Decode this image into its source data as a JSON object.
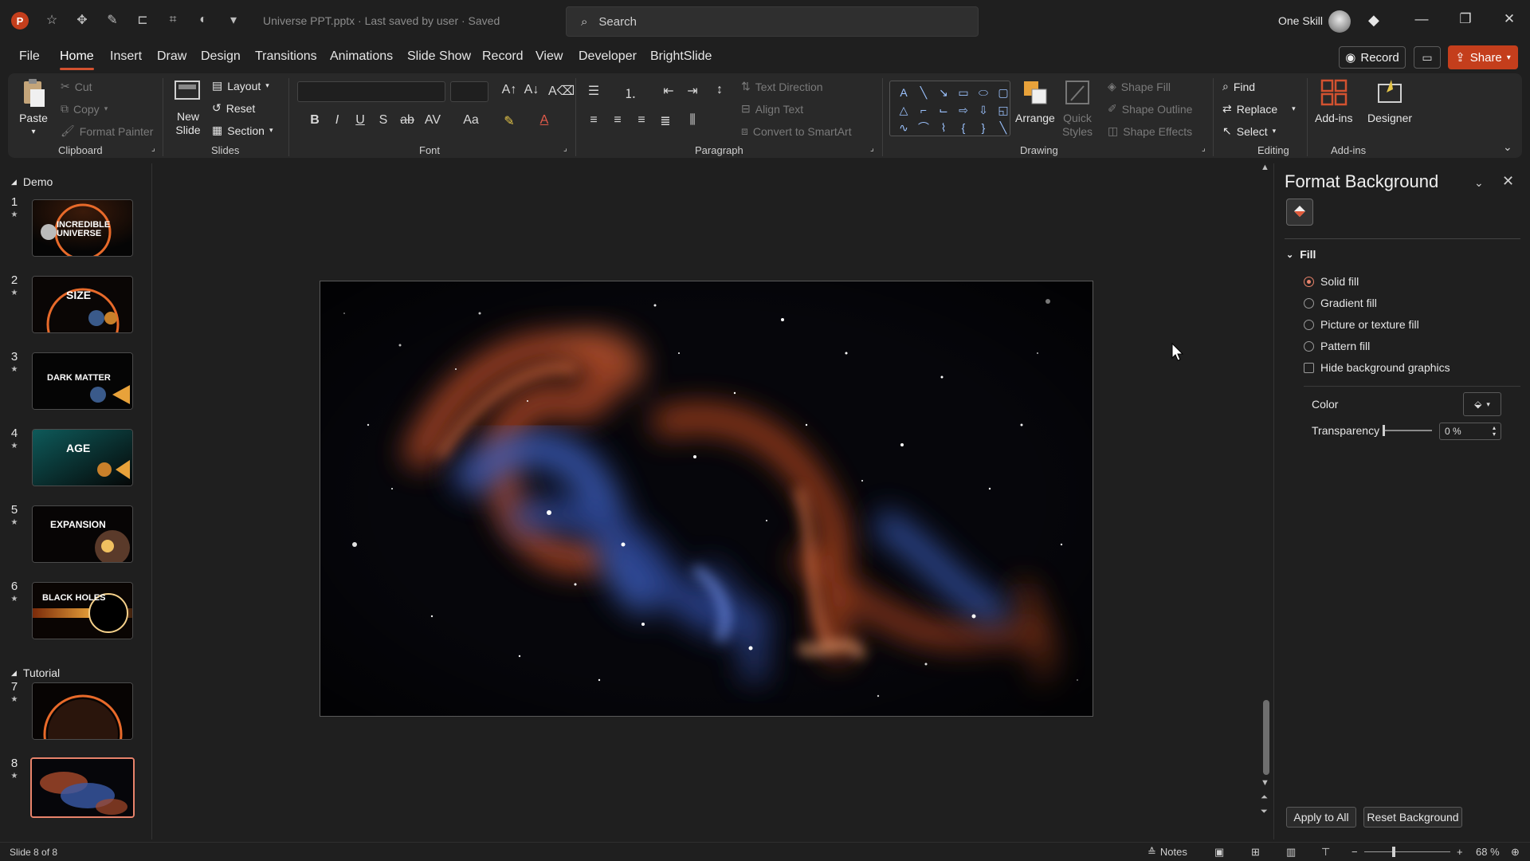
{
  "titlebar": {
    "app_badge": "P",
    "doc_title": "Universe PPT.pptx  ·  Last saved by user  ·  Saved",
    "search_placeholder": "Search",
    "user_name": "One Skill"
  },
  "menu": {
    "items": [
      "File",
      "Home",
      "Insert",
      "Draw",
      "Design",
      "Transitions",
      "Animations",
      "Slide Show",
      "Record",
      "View",
      "Developer",
      "BrightSlide"
    ],
    "active": "Home",
    "record_label": "Record",
    "share_label": "Share"
  },
  "ribbon": {
    "clipboard": {
      "paste": "Paste",
      "cut": "Cut",
      "copy": "Copy",
      "format_painter": "Format Painter",
      "label": "Clipboard"
    },
    "slides": {
      "new_slide": "New Slide",
      "layout": "Layout",
      "reset": "Reset",
      "section": "Section",
      "label": "Slides"
    },
    "font": {
      "label": "Font"
    },
    "paragraph": {
      "text_direction": "Text Direction",
      "align_text": "Align Text",
      "convert_smartart": "Convert to SmartArt",
      "label": "Paragraph"
    },
    "drawing": {
      "arrange": "Arrange",
      "quick_styles": "Quick Styles",
      "shape_fill": "Shape Fill",
      "shape_outline": "Shape Outline",
      "shape_effects": "Shape Effects",
      "label": "Drawing"
    },
    "editing": {
      "find": "Find",
      "replace": "Replace",
      "select": "Select",
      "label": "Editing"
    },
    "addins": {
      "addins": "Add-ins",
      "designer": "Designer",
      "label": "Add-ins"
    }
  },
  "slides_panel": {
    "sections": [
      {
        "name": "Demo"
      },
      {
        "name": "Tutorial"
      }
    ],
    "slides": [
      {
        "number": "1",
        "title": "INCREDIBLE UNIVERSE"
      },
      {
        "number": "2",
        "title": "SIZE"
      },
      {
        "number": "3",
        "title": "DARK MATTER"
      },
      {
        "number": "4",
        "title": "AGE"
      },
      {
        "number": "5",
        "title": "EXPANSION"
      },
      {
        "number": "6",
        "title": "BLACK HOLES"
      },
      {
        "number": "7",
        "title": ""
      },
      {
        "number": "8",
        "title": ""
      }
    ],
    "active_slide": "8"
  },
  "format_pane": {
    "title": "Format Background",
    "fill_header": "Fill",
    "options": [
      "Solid fill",
      "Gradient fill",
      "Picture or texture fill",
      "Pattern fill"
    ],
    "selected_option": "Solid fill",
    "hide_graphics": "Hide background graphics",
    "color_label": "Color",
    "transparency_label": "Transparency",
    "transparency_value": "0 %",
    "apply_all": "Apply to All",
    "reset_background": "Reset Background"
  },
  "statusbar": {
    "slide_info": "Slide 8 of 8",
    "notes": "Notes",
    "zoom": "68 %"
  },
  "colors": {
    "accent": "#c43e1c",
    "selection": "#e8836b",
    "background": "#1f1f1f"
  }
}
